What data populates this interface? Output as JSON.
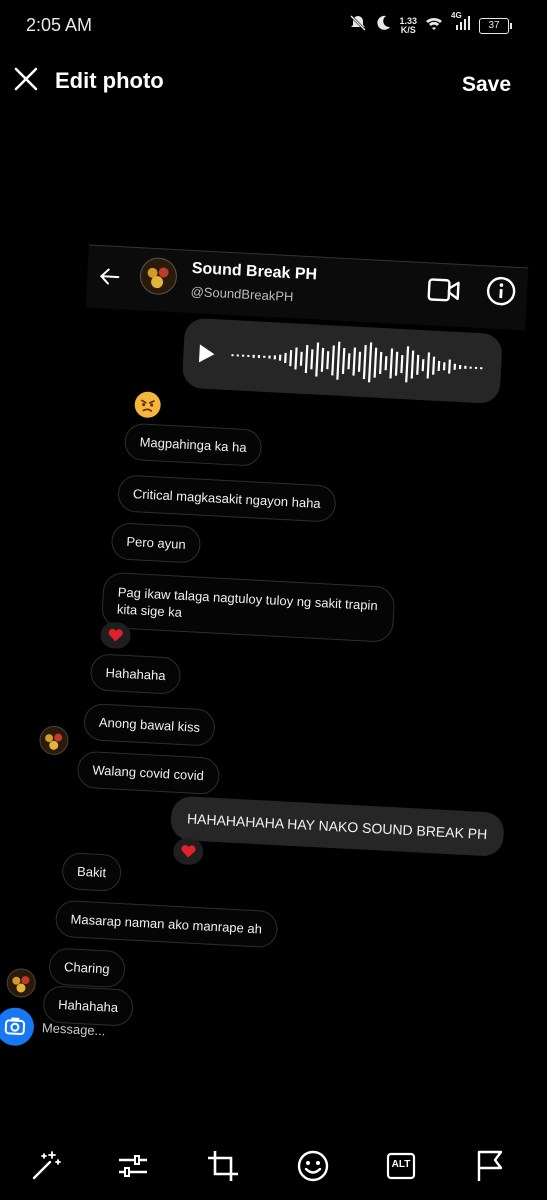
{
  "status": {
    "time": "2:05 AM",
    "net_speed_value": "1.33",
    "net_speed_unit": "K/S",
    "network": "4G",
    "battery": "37"
  },
  "topbar": {
    "title": "Edit photo",
    "save_label": "Save",
    "close_icon": "close-icon"
  },
  "chat": {
    "name": "Sound Break PH",
    "handle": "@SoundBreakPH",
    "messages": [
      "Magpahinga ka ha",
      "Critical magkasakit ngayon haha",
      "Pero ayun",
      "Pag ikaw talaga nagtuloy tuloy ng sakit trapin kita sige ka",
      "Hahahaha",
      "Anong bawal kiss",
      "Walang covid covid",
      "HAHAHAHAHA HAY NAKO SOUND BREAK PH",
      "Bakit",
      "Masarap naman ako manrape ah",
      "Charing",
      "Hahahaha"
    ],
    "message_placeholder": "Message..."
  },
  "toolbar": {
    "icons": [
      "magic-wand-icon",
      "adjust-icon",
      "crop-icon",
      "emoji-icon",
      "alt-text-icon",
      "flag-icon"
    ],
    "alt_label": "ALT"
  },
  "colors": {
    "background": "#000000",
    "accent": "#1877f2",
    "bubble_out": "#262626",
    "heart": "#e0202a"
  }
}
